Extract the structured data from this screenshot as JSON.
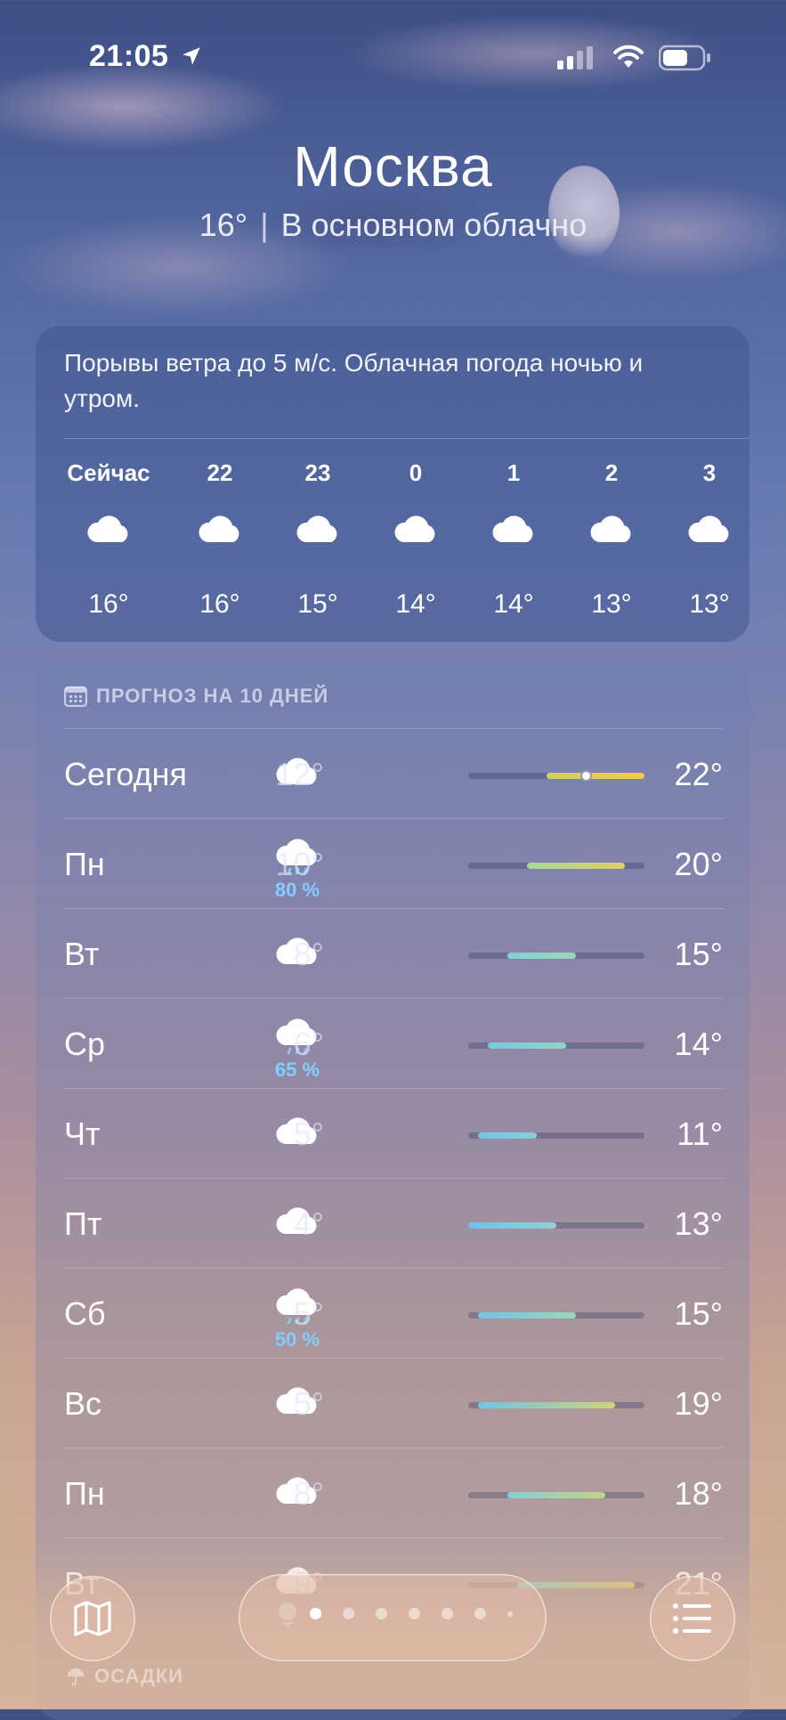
{
  "status_bar": {
    "time": "21:05"
  },
  "location": {
    "city": "Москва",
    "temperature": "16°",
    "separator": "|",
    "condition": "В основном облачно"
  },
  "hourly": {
    "description": "Порывы ветра до 5 м/с. Облачная погода ночью и утром.",
    "items": [
      {
        "label": "Сейчас",
        "icon": "cloud-icon",
        "temp": "16°"
      },
      {
        "label": "22",
        "icon": "cloud-icon",
        "temp": "16°"
      },
      {
        "label": "23",
        "icon": "cloud-icon",
        "temp": "15°"
      },
      {
        "label": "0",
        "icon": "cloud-icon",
        "temp": "14°"
      },
      {
        "label": "1",
        "icon": "cloud-icon",
        "temp": "14°"
      },
      {
        "label": "2",
        "icon": "cloud-icon",
        "temp": "13°"
      },
      {
        "label": "3",
        "icon": "cloud-icon",
        "temp": "13°"
      }
    ]
  },
  "daily": {
    "header": "ПРОГНОЗ НА 10 ДНЕЙ",
    "header_icon": "calendar-icon",
    "range_min": 4,
    "range_max": 22,
    "days": [
      {
        "name": "Сегодня",
        "icon": "cloud-icon",
        "precip": "",
        "low": "12°",
        "high": "22°",
        "low_val": 12,
        "high_val": 22,
        "current_val": 16,
        "colors": [
          "#cfd15a",
          "#f2c94c"
        ]
      },
      {
        "name": "Пн",
        "icon": "cloud-rain-icon",
        "precip": "80 %",
        "low": "10°",
        "high": "20°",
        "low_val": 10,
        "high_val": 20,
        "colors": [
          "#a8d6a0",
          "#e0cd6a"
        ]
      },
      {
        "name": "Вт",
        "icon": "cloud-icon",
        "precip": "",
        "low": "8°",
        "high": "15°",
        "low_val": 8,
        "high_val": 15,
        "colors": [
          "#7fd2d8",
          "#9ed6b8"
        ]
      },
      {
        "name": "Ср",
        "icon": "cloud-rain-icon",
        "precip": "65 %",
        "low": "6°",
        "high": "14°",
        "low_val": 6,
        "high_val": 14,
        "colors": [
          "#75cbe0",
          "#92d4c6"
        ]
      },
      {
        "name": "Чт",
        "icon": "cloud-icon",
        "precip": "",
        "low": "5°",
        "high": "11°",
        "low_val": 5,
        "high_val": 11,
        "colors": [
          "#6fc7e6",
          "#88cfda"
        ]
      },
      {
        "name": "Пт",
        "icon": "cloud-icon",
        "precip": "",
        "low": "4°",
        "high": "13°",
        "low_val": 4,
        "high_val": 13,
        "colors": [
          "#6dc3ea",
          "#8fd2d2"
        ]
      },
      {
        "name": "Сб",
        "icon": "cloud-rain-icon",
        "precip": "50 %",
        "low": "5°",
        "high": "15°",
        "low_val": 5,
        "high_val": 15,
        "colors": [
          "#6fc6e6",
          "#9ad6bc"
        ]
      },
      {
        "name": "Вс",
        "icon": "cloud-icon",
        "precip": "",
        "low": "5°",
        "high": "19°",
        "low_val": 5,
        "high_val": 19,
        "colors": [
          "#6fc6e6",
          "#d2d27a"
        ]
      },
      {
        "name": "Пн",
        "icon": "cloud-icon",
        "precip": "",
        "low": "8°",
        "high": "18°",
        "low_val": 8,
        "high_val": 18,
        "colors": [
          "#80d2d4",
          "#c4d488"
        ]
      },
      {
        "name": "Вт",
        "icon": "cloud-icon",
        "precip": "",
        "low": "9°",
        "high": "21°",
        "low_val": 9,
        "high_val": 21,
        "colors": [
          "#8ad4cc",
          "#e2cd6c"
        ]
      }
    ]
  },
  "next_section": {
    "label": "ОСАДКИ",
    "icon": "umbrella-icon"
  },
  "toolbar": {
    "map_icon": "map-icon",
    "list_icon": "list-icon",
    "pages": 7,
    "active_page": 1
  }
}
